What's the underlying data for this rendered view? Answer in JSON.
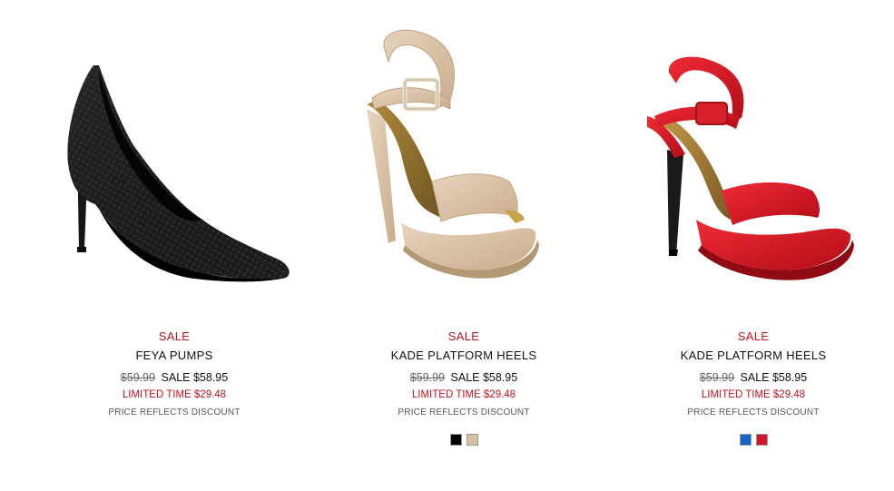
{
  "products": [
    {
      "image": "black-pointed-pump-image",
      "sale_flag": "SALE",
      "title": "FEYA PUMPS",
      "original_price": "$59.99",
      "sale_price": "SALE $58.95",
      "limited_time": "LIMITED TIME $29.48",
      "discount_note": "PRICE REFLECTS DISCOUNT",
      "swatches": []
    },
    {
      "image": "nude-platform-sandal-image",
      "sale_flag": "SALE",
      "title": "KADE PLATFORM HEELS",
      "original_price": "$59.99",
      "sale_price": "SALE $58.95",
      "limited_time": "LIMITED TIME $29.48",
      "discount_note": "PRICE REFLECTS DISCOUNT",
      "swatches": [
        "#000000",
        "#d6bfa2"
      ]
    },
    {
      "image": "red-platform-sandal-image",
      "sale_flag": "SALE",
      "title": "KADE PLATFORM HEELS",
      "original_price": "$59.99",
      "sale_price": "SALE $58.95",
      "limited_time": "LIMITED TIME $29.48",
      "discount_note": "PRICE REFLECTS DISCOUNT",
      "swatches": [
        "#1565c8",
        "#d0142a"
      ]
    }
  ],
  "colors": {
    "sale_red": "#c0161d",
    "text": "#111111"
  }
}
